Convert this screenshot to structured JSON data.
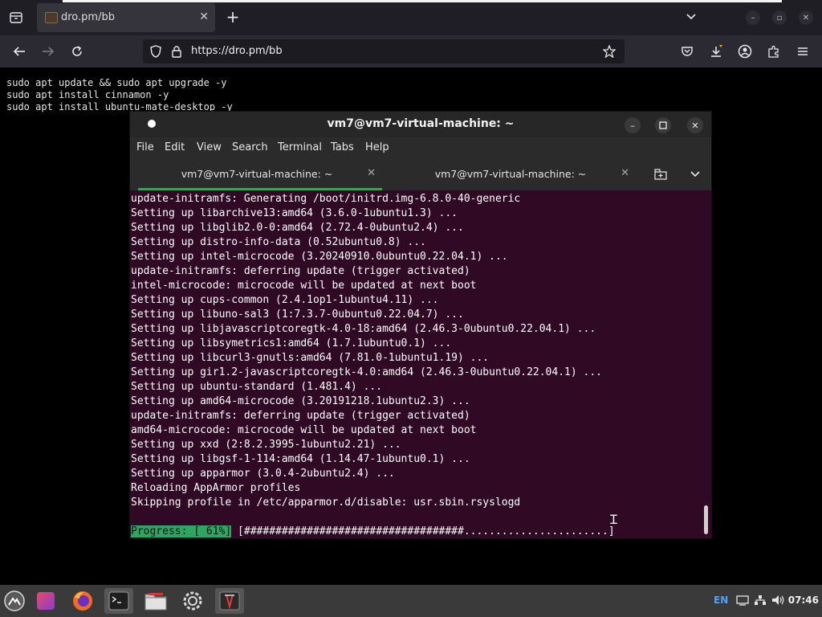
{
  "browser": {
    "tab_title": "dro.pm/bb",
    "url": "https://dro.pm/bb",
    "new_tab_icon": "+",
    "tab_close_icon": "✕"
  },
  "page": {
    "commands": "sudo apt update && sudo apt upgrade -y\nsudo apt install cinnamon -y\nsudo apt install ubuntu-mate-desktop -y"
  },
  "terminal": {
    "title": "vm7@vm7-virtual-machine: ~",
    "menu": [
      "File",
      "Edit",
      "View",
      "Search",
      "Terminal",
      "Tabs",
      "Help"
    ],
    "tabs": [
      {
        "label": "vm7@vm7-virtual-machine: ~"
      },
      {
        "label": "vm7@vm7-virtual-machine: ~"
      }
    ],
    "output": "update-initramfs: Generating /boot/initrd.img-6.8.0-40-generic\nSetting up libarchive13:amd64 (3.6.0-1ubuntu1.3) ...\nSetting up libglib2.0-0:amd64 (2.72.4-0ubuntu2.4) ...\nSetting up distro-info-data (0.52ubuntu0.8) ...\nSetting up intel-microcode (3.20240910.0ubuntu0.22.04.1) ...\nupdate-initramfs: deferring update (trigger activated)\nintel-microcode: microcode will be updated at next boot\nSetting up cups-common (2.4.1op1-1ubuntu4.11) ...\nSetting up libuno-sal3 (1:7.3.7-0ubuntu0.22.04.7) ...\nSetting up libjavascriptcoregtk-4.0-18:amd64 (2.46.3-0ubuntu0.22.04.1) ...\nSetting up libsymetrics1:amd64 (1.7.1ubuntu0.1) ...\nSetting up libcurl3-gnutls:amd64 (7.81.0-1ubuntu1.19) ...\nSetting up gir1.2-javascriptcoregtk-4.0:amd64 (2.46.3-0ubuntu0.22.04.1) ...\nSetting up ubuntu-standard (1.481.4) ...\nSetting up amd64-microcode (3.20191218.1ubuntu2.3) ...\nupdate-initramfs: deferring update (trigger activated)\namd64-microcode: microcode will be updated at next boot\nSetting up xxd (2:8.2.3995-1ubuntu2.21) ...\nSetting up libgsf-1-114:amd64 (1.14.47-1ubuntu0.1) ...\nSetting up apparmor (3.0.4-2ubuntu2.4) ...\nReloading AppArmor profiles\nSkipping profile in /etc/apparmor.d/disable: usr.sbin.rsyslogd",
    "progress_label": "Progress: [ 61%]",
    "progress_bar": " [###################################.......................]",
    "progress_percent": 61
  },
  "taskbar": {
    "language": "EN",
    "clock": "07:46"
  },
  "colors": {
    "terminal_bg": "#300a24",
    "progress_green": "#2ea662",
    "taskbar_bg": "#3a3a3a"
  }
}
